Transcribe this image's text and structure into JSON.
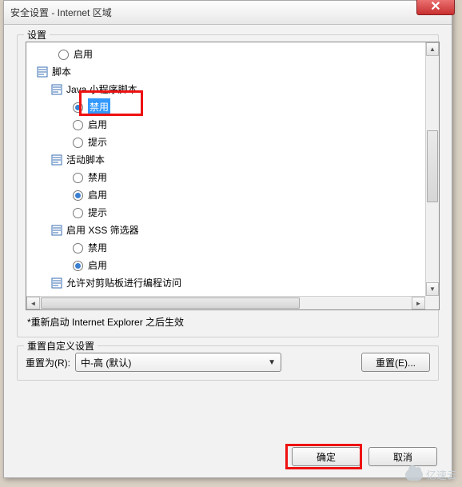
{
  "title": "安全设置 - Internet 区域",
  "settings_label": "设置",
  "tree": {
    "opt_enable_top": "启用",
    "cat_script": "脚本",
    "cat_java": "Java 小程序脚本",
    "java_disable": "禁用",
    "java_enable": "启用",
    "java_prompt": "提示",
    "cat_active": "活动脚本",
    "active_disable": "禁用",
    "active_enable": "启用",
    "active_prompt": "提示",
    "cat_xss": "启用 XSS 筛选器",
    "xss_disable": "禁用",
    "xss_enable": "启用",
    "cat_clipboard": "允许对剪贴板进行编程访问"
  },
  "note": "*重新启动 Internet Explorer 之后生效",
  "reset": {
    "legend": "重置自定义设置",
    "label": "重置为(R):",
    "combo": "中-高 (默认)",
    "button": "重置(E)..."
  },
  "ok": "确定",
  "cancel": "取消",
  "watermark": "亿速云"
}
